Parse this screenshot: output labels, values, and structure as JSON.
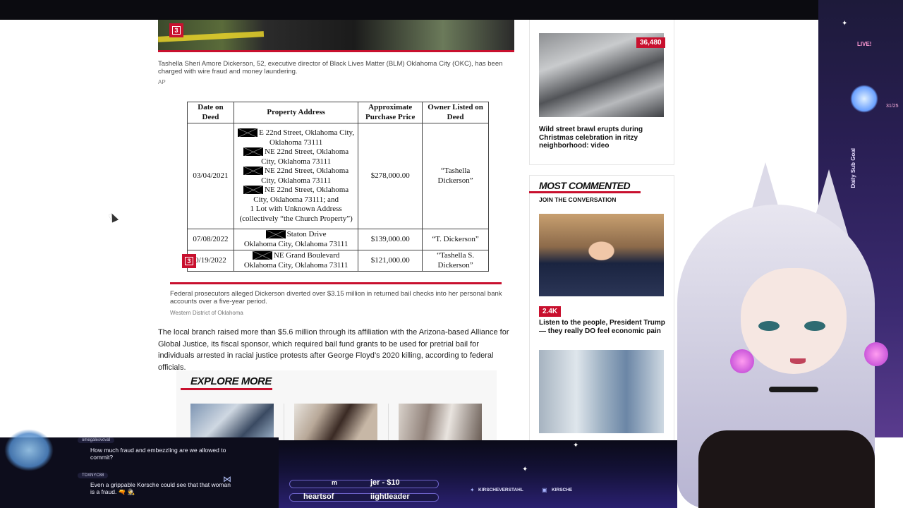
{
  "article": {
    "gallery_count_top": "3",
    "photo_caption": "Tashella Sheri Amore Dickerson, 52, executive director of Black Lives Matter (BLM) Oklahoma City (OKC), has been charged with wire fraud and money laundering.",
    "photo_credit": "AP",
    "table": {
      "headers": [
        "Date on Deed",
        "Property Address",
        "Approximate Purchase Price",
        "Owner Listed on Deed"
      ],
      "rows": [
        {
          "date": "03/04/2021",
          "address_lines": [
            "E 22nd Street, Oklahoma City, Oklahoma 73111",
            "NE 22nd Street, Oklahoma City, Oklahoma 73111",
            "NE 22nd Street, Oklahoma City, Oklahoma 73111",
            "NE 22nd Street, Oklahoma City, Oklahoma 73111; and",
            "1 Lot with Unknown Address (collectively “the Church Property”)"
          ],
          "price": "$278,000.00",
          "owner": "“Tashella Dickerson”"
        },
        {
          "date": "07/08/2022",
          "address_lines": [
            "Staton Drive",
            "Oklahoma City, Oklahoma 73111"
          ],
          "price": "$139,000.00",
          "owner": "“T. Dickerson”"
        },
        {
          "date": "0/19/2022",
          "address_lines": [
            "NE Grand Boulevard",
            "Oklahoma City, Oklahoma 73111"
          ],
          "price": "$121,000.00",
          "owner": "“Tashella S. Dickerson”"
        }
      ]
    },
    "gallery_count_table": "3",
    "table_caption": "Federal prosecutors alleged Dickerson diverted over $3.15 million in returned bail checks into her personal bank accounts over a five-year period.",
    "table_credit": "Western District of Oklahoma",
    "body_paragraph": "The local branch raised more than $5.6 million through its affiliation with the Arizona-based Alliance for Global Justice, its fiscal sponsor, which required bail fund grants to be used for pretrial bail for individuals arrested in racial justice protests after George Floyd’s 2020 killing, according to federal officials.",
    "explore_more_title": "EXPLORE MORE"
  },
  "sidebar": {
    "story1": {
      "count": "36,480",
      "title": "Wild street brawl erupts during Christmas celebration in ritzy neighborhood: video"
    },
    "most_commented": {
      "title": "MOST COMMENTED",
      "subtitle": "JOIN THE CONVERSATION",
      "story": {
        "count": "2.4K",
        "title": "Listen to the people, President Trump — they really DO feel economic pain"
      }
    }
  },
  "overlay": {
    "live_label": "LIVE!",
    "sub_goal_label": "Daily Sub Goal",
    "sub_goal_count": "31/25",
    "chat": [
      {
        "user": "omegalesvoval",
        "message": "How much fraud and embezzling are we allowed to commit?"
      },
      {
        "user": "TDXNYC88",
        "message": "Even a grippable Korsche could see that that woman is a fraud. 🔫 🕵"
      }
    ],
    "ticker_top": "jer - $10",
    "ticker_top_left": "m",
    "ticker_bottom_left": "heartsof",
    "ticker_bottom_right": "iightleader",
    "socials": [
      "KIRSCHEVERSTAHL",
      "KIRSCHE"
    ]
  },
  "colors": {
    "accent_red": "#c8102e"
  }
}
